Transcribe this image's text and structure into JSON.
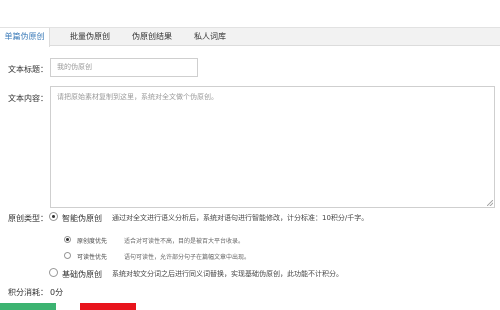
{
  "tabs": [
    {
      "label": "单篇伪原创",
      "active": true
    },
    {
      "label": "批量伪原创",
      "active": false
    },
    {
      "label": "伪原创结果",
      "active": false
    },
    {
      "label": "私人词库",
      "active": false
    }
  ],
  "form": {
    "title_label": "文本标题：",
    "title_placeholder": "我的伪原创",
    "content_label": "文本内容：",
    "content_placeholder": "请把原始素材复制到这里，系统对全文做个伪原创。",
    "type_label": "原创类型：",
    "smart_label": "智能伪原创",
    "smart_desc": "通过对全文进行语义分析后，系统对语句进行智能修改，计分标准：10积分/千字。",
    "sub_option_1_label": "原创度优先",
    "sub_option_1_desc": "适合对可读性不高，目的是被百大平台收录。",
    "sub_option_2_label": "可读性优先",
    "sub_option_2_desc": "语句可读性，允许部分句子在篇幅文章中出现。",
    "basic_label": "基础伪原创",
    "basic_desc": "系统对软文分词之后进行同义词替换，实现基础伪原创，此功能不计积分。",
    "points_label": "积分消耗：",
    "points_value": "0分"
  },
  "colors": {
    "active_tab_text": "#3a7ab8",
    "submit_button": "#3cb371",
    "clear_button": "#e8141c"
  }
}
